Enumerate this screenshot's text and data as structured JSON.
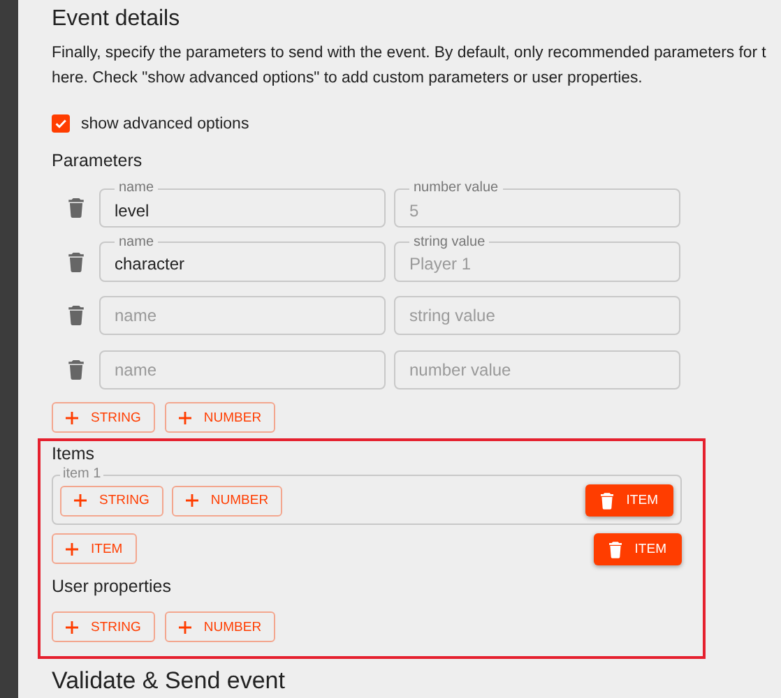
{
  "heading": "Event details",
  "description_lines": [
    "Finally, specify the parameters to send with the event. By default, only recommended parameters for t",
    "here. Check \"show advanced options\" to add custom parameters or user properties."
  ],
  "advanced_option": {
    "label": "show advanced options",
    "checked": true
  },
  "parameters": {
    "title": "Parameters",
    "rows": [
      {
        "name_field": {
          "label": "name",
          "value": "level"
        },
        "value_field": {
          "label": "number value",
          "placeholder": "5"
        }
      },
      {
        "name_field": {
          "label": "name",
          "value": "character"
        },
        "value_field": {
          "label": "string value",
          "placeholder": "Player 1"
        }
      },
      {
        "name_field": {
          "placeholder": "name"
        },
        "value_field": {
          "placeholder": "string value"
        }
      },
      {
        "name_field": {
          "placeholder": "name"
        },
        "value_field": {
          "placeholder": "number value"
        }
      }
    ],
    "buttons": [
      {
        "label": "STRING",
        "kind": "outlined"
      },
      {
        "label": "NUMBER",
        "kind": "outlined"
      }
    ]
  },
  "items": {
    "title": "Items",
    "groups": [
      {
        "label": "item 1",
        "buttons": [
          {
            "label": "STRING",
            "kind": "outlined"
          },
          {
            "label": "NUMBER",
            "kind": "outlined"
          }
        ],
        "remove_button": {
          "label": "ITEM",
          "kind": "filled"
        }
      }
    ],
    "actions": [
      {
        "label": "ITEM",
        "kind": "outlined"
      },
      {
        "label": "ITEM",
        "kind": "filled"
      }
    ]
  },
  "user_properties": {
    "title": "User properties",
    "buttons": [
      {
        "label": "STRING",
        "kind": "outlined"
      },
      {
        "label": "NUMBER",
        "kind": "outlined"
      }
    ]
  },
  "next_heading": "Validate & Send event"
}
